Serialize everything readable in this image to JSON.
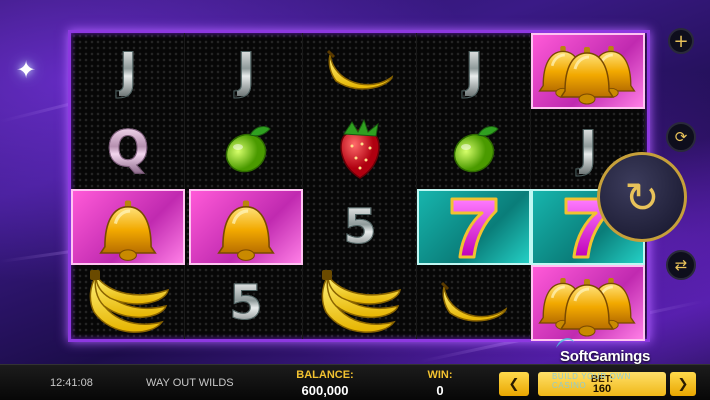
{
  "game": {
    "title": "WAY OUT WILDS",
    "time": "12:41:08"
  },
  "footer": {
    "balance_label": "BALANCE:",
    "balance_value": "600,000",
    "win_label": "WIN:",
    "win_value": "0",
    "bet_label": "BET:",
    "bet_value": "160",
    "bet_decrease_symbol": "❮",
    "bet_increase_symbol": "❯"
  },
  "watermark": {
    "brand": "SoftGamings",
    "tagline": "BUILD YOUR OWN CASINO"
  },
  "reels": [
    [
      "J",
      "Q",
      "bell",
      "banana-bunch"
    ],
    [
      "J",
      "lime",
      "bell",
      "5"
    ],
    [
      "banana",
      "strawberry",
      "5",
      "banana-bunch"
    ],
    [
      "J",
      "lime",
      "seven",
      "banana"
    ],
    [
      "bell-pair",
      "J",
      "seven",
      "bell-pair"
    ]
  ],
  "highlights": {
    "bell": "pink",
    "bell-pair": "pink",
    "seven": "teal"
  },
  "colors": {
    "frame": "#8d38e0",
    "accent_gold": "#f2c230",
    "background": "#2b1466"
  },
  "icons": {
    "add": "plus-icon",
    "autoplay": "autoplay-icon",
    "spin": "spin-icon",
    "quick": "quick-spin-icon"
  }
}
